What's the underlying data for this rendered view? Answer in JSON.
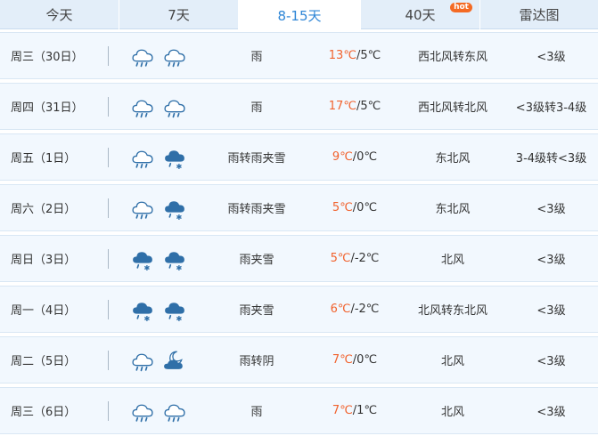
{
  "tabs": [
    {
      "label": "今天",
      "active": false
    },
    {
      "label": "7天",
      "active": false
    },
    {
      "label": "8-15天",
      "active": true
    },
    {
      "label": "40天",
      "active": false,
      "badge": "hot"
    },
    {
      "label": "雷达图",
      "active": false
    }
  ],
  "colors": {
    "accent": "#2f86d6",
    "high_temp": "#f1622d",
    "badge": "#f46a24",
    "row_bg": "#f2f8fe"
  },
  "forecast": [
    {
      "day": "周三（30日）",
      "icons": [
        "rain-icon",
        "rain-icon"
      ],
      "desc": "雨",
      "high": "13℃",
      "low": "/5℃",
      "wind": "西北风转东风",
      "level": "<3级"
    },
    {
      "day": "周四（31日）",
      "icons": [
        "rain-icon",
        "rain-icon"
      ],
      "desc": "雨",
      "high": "17℃",
      "low": "/5℃",
      "wind": "西北风转北风",
      "level": "<3级转3-4级"
    },
    {
      "day": "周五（1日）",
      "icons": [
        "rain-icon",
        "sleet-icon"
      ],
      "desc": "雨转雨夹雪",
      "high": "9℃",
      "low": "/0℃",
      "wind": "东北风",
      "level": "3-4级转<3级"
    },
    {
      "day": "周六（2日）",
      "icons": [
        "rain-icon",
        "sleet-icon"
      ],
      "desc": "雨转雨夹雪",
      "high": "5℃",
      "low": "/0℃",
      "wind": "东北风",
      "level": "<3级"
    },
    {
      "day": "周日（3日）",
      "icons": [
        "sleet-icon",
        "sleet-icon"
      ],
      "desc": "雨夹雪",
      "high": "5℃",
      "low": "/-2℃",
      "wind": "北风",
      "level": "<3级"
    },
    {
      "day": "周一（4日）",
      "icons": [
        "sleet-icon",
        "sleet-icon"
      ],
      "desc": "雨夹雪",
      "high": "6℃",
      "low": "/-2℃",
      "wind": "北风转东北风",
      "level": "<3级"
    },
    {
      "day": "周二（5日）",
      "icons": [
        "rain-icon",
        "overcast-night-icon"
      ],
      "desc": "雨转阴",
      "high": "7℃",
      "low": "/0℃",
      "wind": "北风",
      "level": "<3级"
    },
    {
      "day": "周三（6日）",
      "icons": [
        "rain-icon",
        "rain-icon"
      ],
      "desc": "雨",
      "high": "7℃",
      "low": "/1℃",
      "wind": "北风",
      "level": "<3级"
    }
  ]
}
